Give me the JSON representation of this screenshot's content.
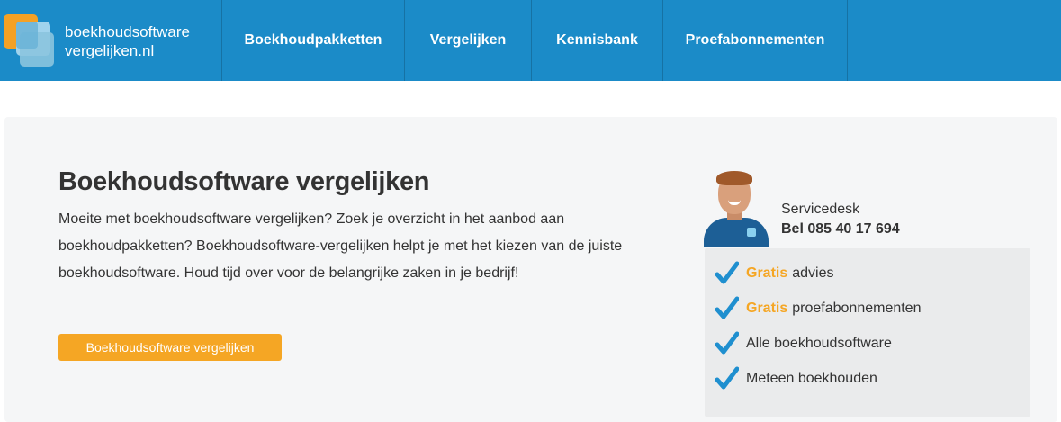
{
  "header": {
    "logo": {
      "line1": "boekhoudsoftware",
      "line2": "vergelijken.nl"
    },
    "nav": [
      {
        "label": "Boekhoudpakketten"
      },
      {
        "label": "Vergelijken"
      },
      {
        "label": "Kennisbank"
      },
      {
        "label": "Proefabonnementen"
      }
    ]
  },
  "hero": {
    "title": "Boekhoudsoftware vergelijken",
    "text": "Moeite met boekhoudsoftware vergelijken? Zoek je overzicht in het aanbod aan boekhoudpakketten? Boekhoudsoftware-vergelijken helpt je met het kiezen van de juiste boekhoudsoftware. Houd tijd over voor de belangrijke zaken in je bedrijf!",
    "cta_label": "Boekhoudsoftware vergelijken"
  },
  "servicedesk": {
    "label": "Servicedesk",
    "phone": "Bel 085 40 17 694"
  },
  "benefits": [
    {
      "highlight": "Gratis",
      "text": "advies"
    },
    {
      "highlight": "Gratis",
      "text": "proefabonnementen"
    },
    {
      "highlight": "",
      "text": "Alle boekhoudsoftware"
    },
    {
      "highlight": "",
      "text": "Meteen boekhouden"
    }
  ],
  "colors": {
    "header_bg": "#1b8bc8",
    "accent_orange": "#f5a624",
    "check_blue": "#1f8fcf",
    "panel_bg": "#f5f6f7"
  },
  "icons": [
    "logo-icon",
    "checkmark-icon"
  ]
}
